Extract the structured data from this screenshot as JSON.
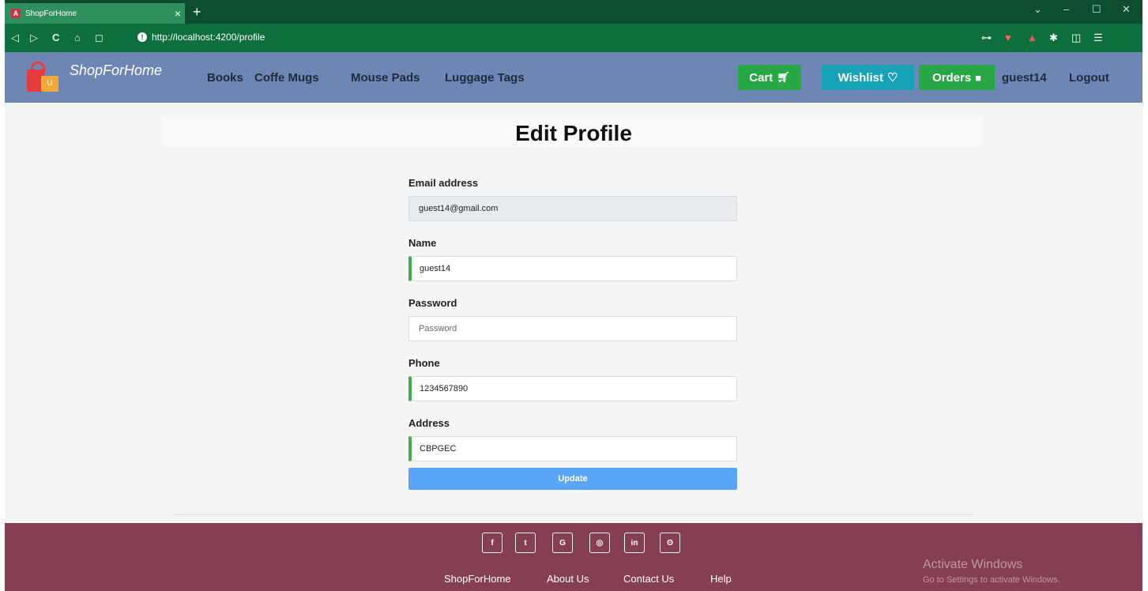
{
  "browser": {
    "tab_title": "ShopForHome",
    "tab_close": "×",
    "new_tab": "+",
    "url": "http://localhost:4200/profile",
    "nav": {
      "back": "◁",
      "forward": "▷",
      "reload": "C",
      "home": "⌂",
      "bookmark": "◻"
    },
    "window": {
      "menu": "⌄",
      "minimize": "–",
      "maximize": "☐",
      "close": "✕"
    }
  },
  "navbar": {
    "brand": "ShopForHome",
    "brand_logo_letter": "U",
    "categories": [
      "Books",
      "Coffe Mugs",
      "Mouse Pads",
      "Luggage Tags"
    ],
    "cart_label": "Cart",
    "wishlist_label": "Wishlist",
    "orders_label": "Orders",
    "username": "guest14",
    "logout_label": "Logout",
    "colors": {
      "bg": "#6d86b3",
      "cart": "#28a745",
      "wishlist": "#17a2b8",
      "orders": "#28a745"
    }
  },
  "page": {
    "title": "Edit Profile",
    "form": {
      "email_label": "Email address",
      "email_value": "guest14@gmail.com",
      "name_label": "Name",
      "name_value": "guest14",
      "password_label": "Password",
      "password_placeholder": "Password",
      "phone_label": "Phone",
      "phone_value": "1234567890",
      "address_label": "Address",
      "address_value": "CBPGEC",
      "submit_label": "Update"
    }
  },
  "footer": {
    "social": [
      "f",
      "t",
      "G",
      "◎",
      "in",
      "ʘ"
    ],
    "social_icons": [
      "facebook-icon",
      "twitter-icon",
      "google-icon",
      "instagram-icon",
      "linkedin-icon",
      "github-icon"
    ],
    "links": [
      "ShopForHome",
      "About Us",
      "Contact Us",
      "Help"
    ],
    "bg": "#853e52"
  },
  "watermark": {
    "title": "Activate Windows",
    "subtitle": "Go to Settings to activate Windows."
  }
}
